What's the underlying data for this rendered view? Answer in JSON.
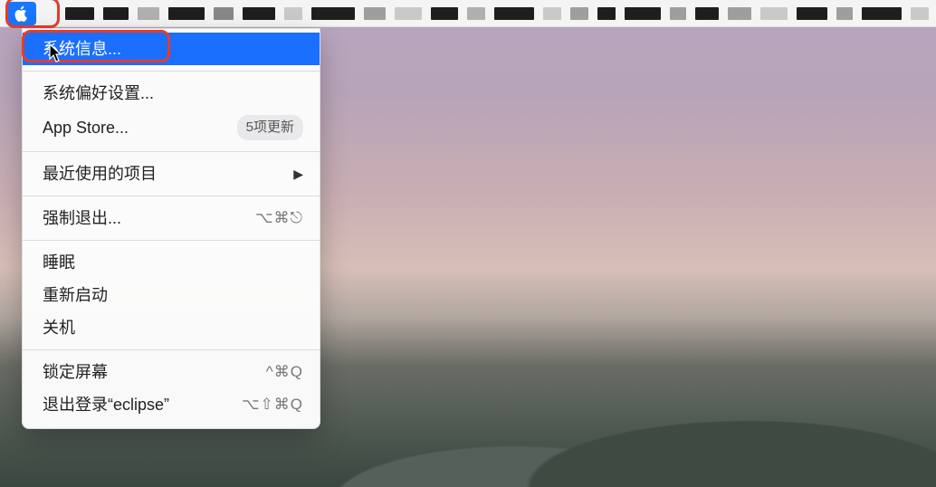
{
  "menubar": {
    "apple_icon": "apple-logo"
  },
  "menu": {
    "system_info": "系统信息...",
    "system_prefs": "系统偏好设置...",
    "app_store": "App Store...",
    "app_store_badge": "5项更新",
    "recent_items": "最近使用的项目",
    "force_quit": "强制退出...",
    "force_quit_key": "⌥⌘⎋",
    "sleep": "睡眠",
    "restart": "重新启动",
    "shutdown": "关机",
    "lock_screen": "锁定屏幕",
    "lock_screen_key": "^⌘Q",
    "logout": "退出登录“eclipse”",
    "logout_key": "⌥⇧⌘Q"
  },
  "bar_blocks": [
    {
      "w": 32,
      "c": "#1e1e1e"
    },
    {
      "w": 28,
      "c": "#1e1e1e"
    },
    {
      "w": 24,
      "c": "#b0b0b0"
    },
    {
      "w": 40,
      "c": "#1e1e1e"
    },
    {
      "w": 22,
      "c": "#888"
    },
    {
      "w": 36,
      "c": "#1e1e1e"
    },
    {
      "w": 20,
      "c": "#c9c9c9"
    },
    {
      "w": 48,
      "c": "#1e1e1e"
    },
    {
      "w": 24,
      "c": "#9e9e9e"
    },
    {
      "w": 30,
      "c": "#c9c9c9"
    },
    {
      "w": 30,
      "c": "#1e1e1e"
    },
    {
      "w": 20,
      "c": "#b0b0b0"
    },
    {
      "w": 44,
      "c": "#1e1e1e"
    },
    {
      "w": 20,
      "c": "#c9c9c9"
    },
    {
      "w": 20,
      "c": "#9e9e9e"
    },
    {
      "w": 20,
      "c": "#1e1e1e"
    },
    {
      "w": 40,
      "c": "#1e1e1e"
    },
    {
      "w": 18,
      "c": "#9e9e9e"
    },
    {
      "w": 26,
      "c": "#1e1e1e"
    },
    {
      "w": 26,
      "c": "#9e9e9e"
    },
    {
      "w": 30,
      "c": "#c9c9c9"
    },
    {
      "w": 34,
      "c": "#1e1e1e"
    },
    {
      "w": 18,
      "c": "#9e9e9e"
    },
    {
      "w": 44,
      "c": "#1e1e1e"
    },
    {
      "w": 20,
      "c": "#c9c9c9"
    }
  ]
}
